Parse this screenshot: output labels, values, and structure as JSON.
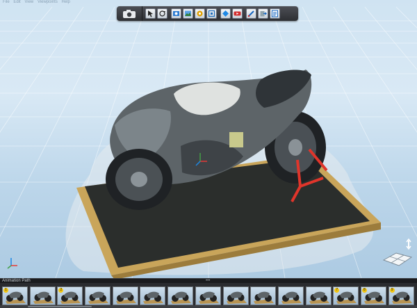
{
  "menubar": {
    "items": [
      "File",
      "Edit",
      "View",
      "Viewpoints",
      "Help"
    ]
  },
  "toolbar": {
    "buttons": [
      {
        "name": "camera-icon"
      },
      {
        "name": "select-icon"
      },
      {
        "name": "orbit-icon"
      },
      {
        "name": "render-icon"
      },
      {
        "name": "image-export-icon"
      },
      {
        "name": "navigation-icon"
      },
      {
        "name": "zoom-extents-icon"
      },
      {
        "name": "material-icon"
      },
      {
        "name": "youtube-icon"
      },
      {
        "name": "measure-icon"
      },
      {
        "name": "export-icon"
      },
      {
        "name": "properties-icon"
      }
    ]
  },
  "panel": {
    "title": "Animation Path",
    "grip": "•••"
  },
  "thumbnails": [
    {
      "num": "1"
    },
    {
      "num": ""
    },
    {
      "num": "2"
    },
    {
      "num": ""
    },
    {
      "num": ""
    },
    {
      "num": ""
    },
    {
      "num": ""
    },
    {
      "num": ""
    },
    {
      "num": ""
    },
    {
      "num": ""
    },
    {
      "num": ""
    },
    {
      "num": ""
    },
    {
      "num": "7"
    },
    {
      "num": "8"
    },
    {
      "num": "9"
    }
  ],
  "colors": {
    "stand": "#e0352b",
    "base_wood": "#c9a55a",
    "base_top": "#2b2e2c",
    "body": "#5d6468",
    "fairing": "#dfe2e0"
  }
}
